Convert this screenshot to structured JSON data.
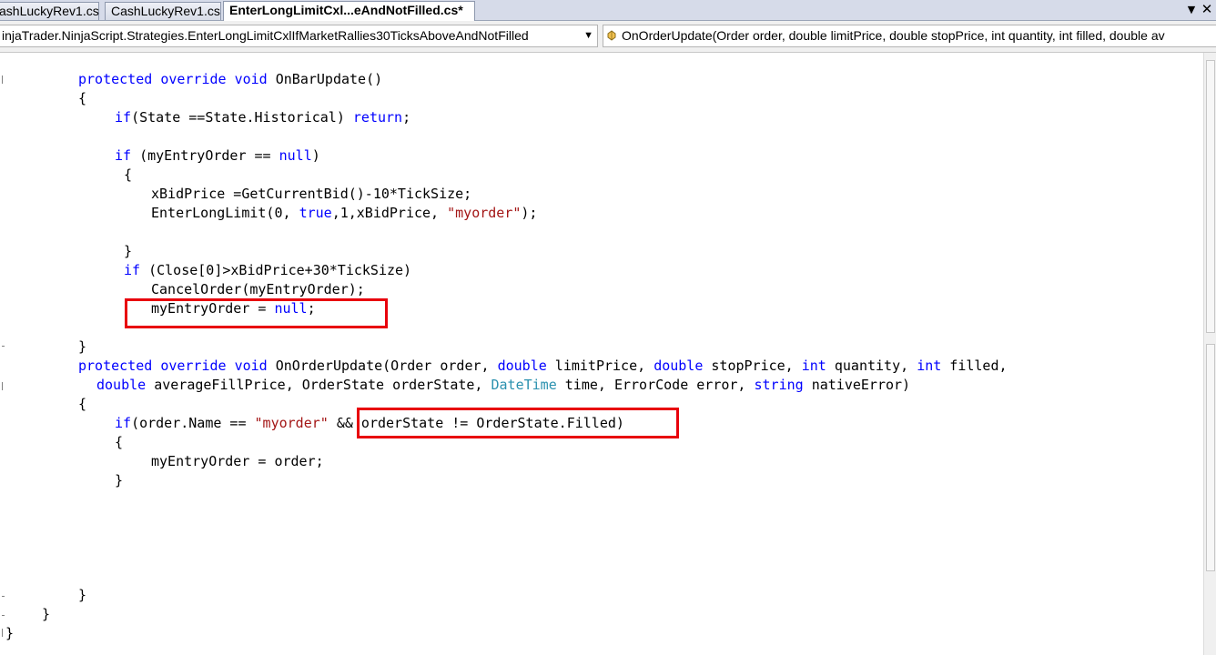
{
  "tabs": [
    {
      "label": "ashLuckyRev1.cs",
      "active": false
    },
    {
      "label": "CashLuckyRev1.cs",
      "active": false
    },
    {
      "label": "EnterLongLimitCxl...eAndNotFilled.cs*",
      "active": true
    }
  ],
  "tab_controls": {
    "dropdown_icon": "▼",
    "close_icon": "✕"
  },
  "navigation": {
    "type_combo": "injaTrader.NinjaScript.Strategies.EnterLongLimitCxlIfMarketRallies30TicksAboveAndNotFilled",
    "member_combo": "OnOrderUpdate(Order order, double limitPrice, double stopPrice, int quantity, int filled, double av",
    "combo_arrow": "▼",
    "member_icon": "method-icon"
  },
  "colors": {
    "keyword": "#0000ff",
    "string": "#a31515",
    "type": "#2b91af",
    "highlight": "#e8000c"
  },
  "code": {
    "l1": {
      "p1": "protected",
      "p2": " ",
      "p3": "override",
      "p4": " ",
      "p5": "void",
      "p6": " OnBarUpdate()"
    },
    "l2": "{",
    "l3": {
      "p1": "if",
      "p2": "(State ==State.Historical) ",
      "p3": "return",
      "p4": ";"
    },
    "l5": {
      "p1": "if",
      "p2": " (myEntryOrder == ",
      "p3": "null",
      "p4": ")"
    },
    "l6": "{",
    "l7": "xBidPrice =GetCurrentBid()-10*TickSize;",
    "l8": {
      "p1": "EnterLongLimit(0, ",
      "p2": "true",
      "p3": ",1,xBidPrice, ",
      "p4": "\"myorder\"",
      "p5": ");"
    },
    "l10": "}",
    "l11": {
      "p1": "if",
      "p2": " (Close[0]>xBidPrice+30*TickSize)"
    },
    "l12": "CancelOrder(myEntryOrder);",
    "l13": {
      "p1": "myEntryOrder = ",
      "p2": "null",
      "p3": ";"
    },
    "l15": "}",
    "l16": {
      "p1": "protected",
      "p2": " ",
      "p3": "override",
      "p4": " ",
      "p5": "void",
      "p6": " OnOrderUpdate(Order order, ",
      "p7": "double",
      "p8": " limitPrice, ",
      "p9": "double",
      "p10": " stopPrice, ",
      "p11": "int",
      "p12": " quantity, ",
      "p13": "int",
      "p14": " filled,"
    },
    "l17": {
      "p1": "double",
      "p2": " averageFillPrice, OrderState orderState, ",
      "p3": "DateTime",
      "p4": " time, ErrorCode error, ",
      "p5": "string",
      "p6": " nativeError)"
    },
    "l18": "{",
    "l19": {
      "p1": "if",
      "p2": "(order.Name == ",
      "p3": "\"myorder\"",
      "p4": " && orderState != OrderState.Filled)"
    },
    "l20": "{",
    "l21": "myEntryOrder = order;",
    "l22": "}",
    "l28": "}",
    "l29": "}",
    "l30": "}"
  }
}
